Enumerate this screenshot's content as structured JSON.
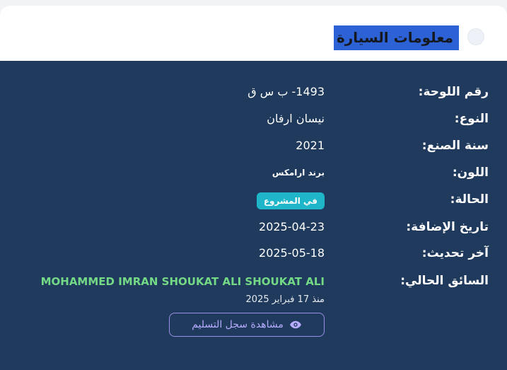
{
  "header": {
    "title": "معلومات السيارة"
  },
  "details": {
    "plate": {
      "label": "رقم اللوحة:",
      "value": "1493- ب س ق"
    },
    "type": {
      "label": "النوع:",
      "value": "نيسان ارفان"
    },
    "year": {
      "label": "سنة الصنع:",
      "value": "2021"
    },
    "color": {
      "label": "اللون:",
      "value": "برند ارامكس"
    },
    "status": {
      "label": "الحالة:",
      "value": "في المشروع",
      "badge_color": "#1fb6c9"
    },
    "added": {
      "label": "تاريخ الإضافة:",
      "value": "2025-04-23"
    },
    "updated": {
      "label": "آخر تحديث:",
      "value": "2025-05-18"
    },
    "driver": {
      "label": "السائق الحالي:",
      "name": "MOHAMMED IMRAN SHOUKAT ALI SHOUKAT ALI",
      "since": "منذ 17 فبراير 2025",
      "history_button": "مشاهدة سجل التسليم",
      "history_icon": "eye-icon"
    }
  },
  "colors": {
    "panel": "#1f3a5c",
    "title_highlight": "#2c62d6",
    "driver_name": "#74d986",
    "button_border": "#9a8fe6"
  }
}
